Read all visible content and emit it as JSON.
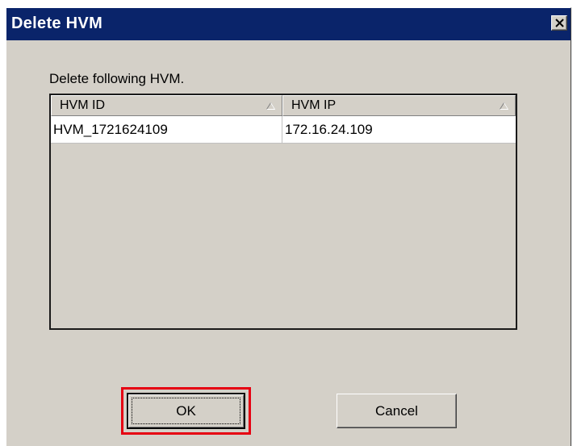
{
  "dialog": {
    "title": "Delete HVM",
    "message": "Delete following HVM."
  },
  "table": {
    "columns": [
      "HVM ID",
      "HVM IP"
    ],
    "rows": [
      [
        "HVM_1721624109",
        "172.16.24.109"
      ]
    ]
  },
  "buttons": {
    "ok_label": "OK",
    "cancel_label": "Cancel"
  },
  "colors": {
    "titlebar": "#0a246a",
    "dialog_bg": "#d4d0c8",
    "highlight": "#e60012"
  },
  "icons": {
    "close": "close-icon",
    "sort": "sort-ascending-icon"
  }
}
